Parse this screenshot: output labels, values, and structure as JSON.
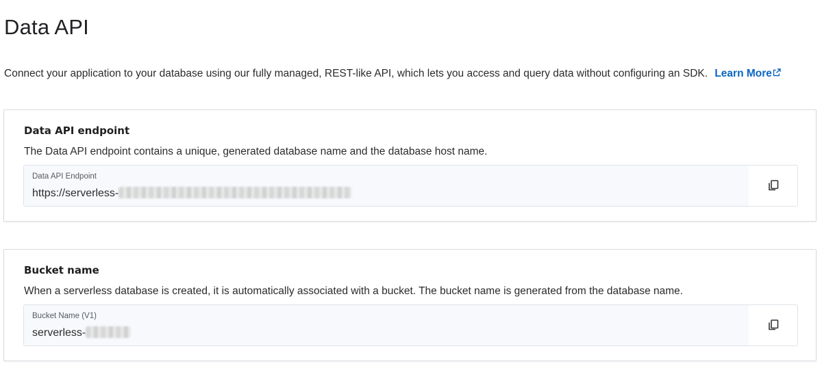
{
  "page": {
    "title": "Data API",
    "intro": "Connect your application to your database using our fully managed, REST-like API, which lets you access and query data without configuring an SDK.",
    "learn_more": "Learn More",
    "learn_more_icon": "external-link-icon"
  },
  "endpoint_card": {
    "title": "Data API endpoint",
    "description": "The Data API endpoint contains a unique, generated database name and the database host name.",
    "field_label": "Data API Endpoint",
    "field_value_prefix": "https://serverless-",
    "copy_icon": "copy-icon"
  },
  "bucket_card": {
    "title": "Bucket name",
    "description": "When a serverless database is created, it is automatically associated with a bucket. The bucket name is generated from the database name.",
    "field_label": "Bucket Name (V1)",
    "field_value_prefix": "serverless-",
    "copy_icon": "copy-icon"
  },
  "colors": {
    "link": "#0a66c2",
    "field_background": "#f7f9fc",
    "border": "#d7dbe0"
  }
}
